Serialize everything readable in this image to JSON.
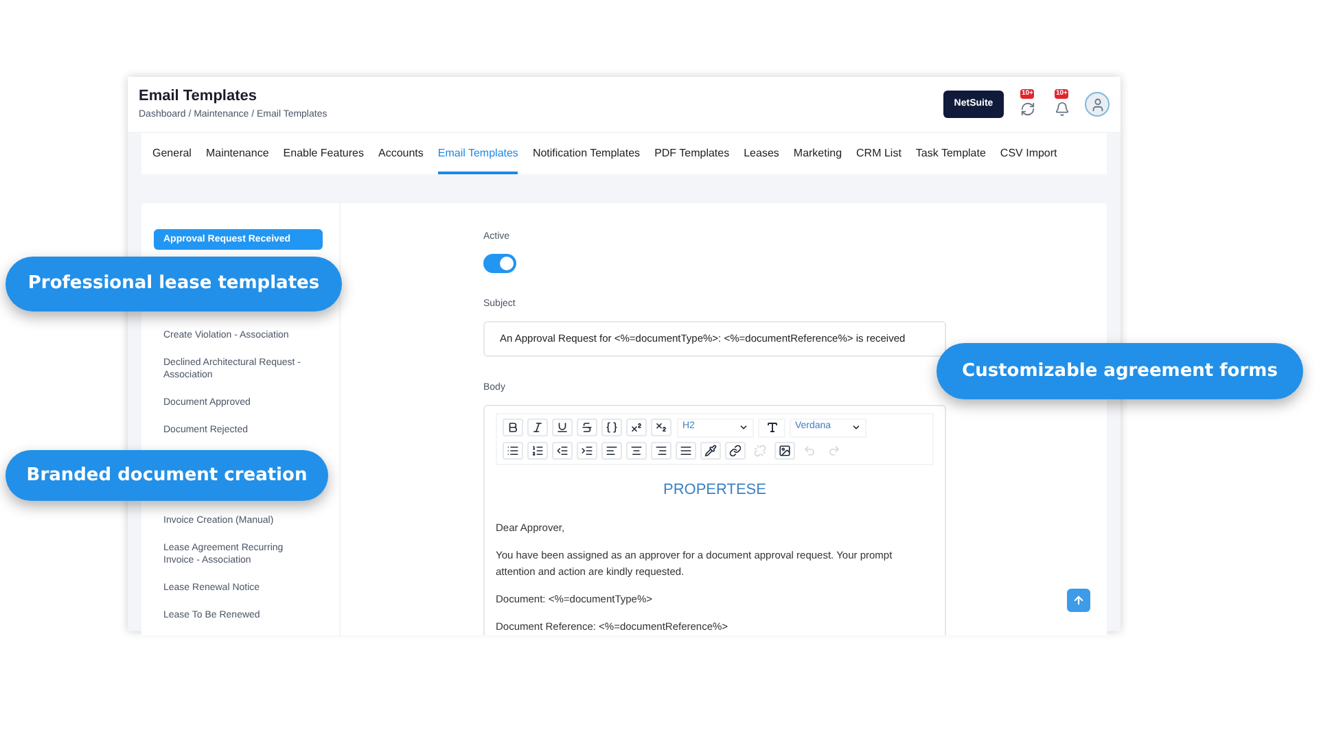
{
  "window": {
    "title": "Email Templates",
    "breadcrumb": "Dashboard / Maintenance / Email Templates"
  },
  "header": {
    "account_button": "NetSuite",
    "notifications": [
      {
        "kind": "sync",
        "badge": "10+"
      },
      {
        "kind": "bell",
        "badge": "10+"
      }
    ]
  },
  "tabs": [
    {
      "label": "General",
      "selected": false
    },
    {
      "label": "Maintenance",
      "selected": false
    },
    {
      "label": "Enable Features",
      "selected": false
    },
    {
      "label": "Accounts",
      "selected": false
    },
    {
      "label": "Email Templates",
      "selected": true
    },
    {
      "label": "Notification Templates",
      "selected": false
    },
    {
      "label": "PDF Templates",
      "selected": false
    },
    {
      "label": "Leases",
      "selected": false
    },
    {
      "label": "Marketing",
      "selected": false
    },
    {
      "label": "CRM List",
      "selected": false
    },
    {
      "label": "Task Template",
      "selected": false
    },
    {
      "label": "CSV Import",
      "selected": false
    }
  ],
  "sidebar": {
    "items": [
      {
        "kind": "template",
        "label": "Approval Request Received",
        "selected": true
      },
      {
        "kind": "callout",
        "label": "Professional lease templates"
      },
      {
        "kind": "template",
        "label": "Create Violation - Association",
        "selected": false
      },
      {
        "kind": "template",
        "label": "Declined Architectural Request - Association",
        "selected": false
      },
      {
        "kind": "template",
        "label": "Document Approved",
        "selected": false
      },
      {
        "kind": "template",
        "label": "Document Rejected",
        "selected": false
      },
      {
        "kind": "callout",
        "label": "Branded document creation"
      },
      {
        "kind": "template",
        "label": "Invoice Creation (Manual)",
        "selected": false
      },
      {
        "kind": "template",
        "label": "Lease Agreement Recurring Invoice - Association",
        "selected": false
      },
      {
        "kind": "template",
        "label": "Lease Renewal Notice",
        "selected": false
      },
      {
        "kind": "template",
        "label": "Lease To Be Renewed",
        "selected": false
      }
    ]
  },
  "form": {
    "active_label": "Active",
    "active": true,
    "subject_label": "Subject",
    "subject": "An Approval Request for <%=documentType%>: <%=documentReference%> is received",
    "callout": "Customizable agreement forms",
    "body_label": "Body",
    "toolbar": {
      "heading": "H2",
      "font": "Verdana",
      "text_tools": [
        {
          "kind": "bold",
          "disabled": false
        },
        {
          "kind": "italic",
          "disabled": false
        },
        {
          "kind": "underline",
          "disabled": false
        },
        {
          "kind": "strike",
          "disabled": false
        },
        {
          "kind": "code",
          "disabled": false
        },
        {
          "kind": "superscript",
          "disabled": false
        },
        {
          "kind": "subscript",
          "disabled": false
        }
      ],
      "block_tools": [
        {
          "kind": "bullets",
          "disabled": false
        },
        {
          "kind": "numbers",
          "disabled": false
        },
        {
          "kind": "outdent",
          "disabled": false
        },
        {
          "kind": "indent",
          "disabled": false
        },
        {
          "kind": "align-left",
          "disabled": false
        },
        {
          "kind": "align-center",
          "disabled": false
        },
        {
          "kind": "align-right",
          "disabled": false
        },
        {
          "kind": "justify",
          "disabled": false
        },
        {
          "kind": "color",
          "disabled": false
        },
        {
          "kind": "link",
          "disabled": false
        },
        {
          "kind": "unlink",
          "disabled": true
        },
        {
          "kind": "image",
          "disabled": false
        },
        {
          "kind": "undo",
          "disabled": true
        },
        {
          "kind": "redo",
          "disabled": true
        }
      ]
    },
    "body": {
      "heading": "PROPERTESE",
      "paragraphs": [
        "Dear Approver,",
        "You have been assigned as an approver for a document approval request. Your prompt attention and action are kindly requested.",
        "Document: <%=documentType%>",
        "Document Reference: <%=documentReference%>"
      ]
    }
  }
}
